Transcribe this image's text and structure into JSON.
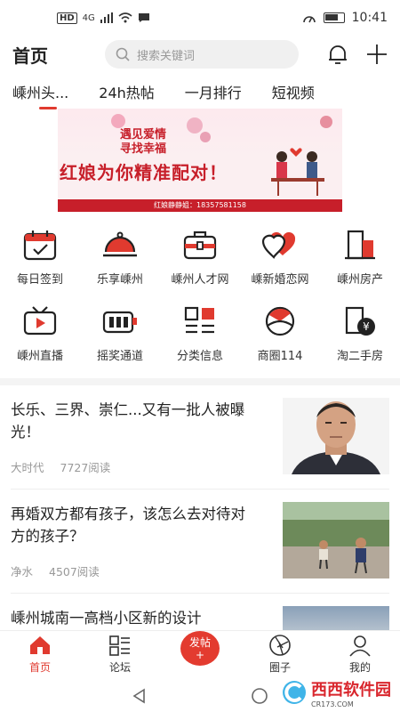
{
  "status": {
    "carrier": "HD",
    "signal": "4G",
    "time": "10:41"
  },
  "header": {
    "title": "首页",
    "search_placeholder": "搜索关键词"
  },
  "tabs": [
    {
      "label": "嵊州头..."
    },
    {
      "label": "24h热帖"
    },
    {
      "label": "一月排行"
    },
    {
      "label": "短视频"
    }
  ],
  "banner": {
    "slogan_line1": "遇见爱情",
    "slogan_line2": "寻找幸福",
    "headline": "红娘为你精准配对！",
    "contact": "红娘静静姐：18357581158"
  },
  "grid": [
    [
      {
        "label": "每日签到",
        "icon": "calendar-check-icon"
      },
      {
        "label": "乐享嵊州",
        "icon": "food-cloche-icon"
      },
      {
        "label": "嵊州人才网",
        "icon": "briefcase-icon"
      },
      {
        "label": "嵊新婚恋网",
        "icon": "hearts-icon"
      },
      {
        "label": "嵊州房产",
        "icon": "building-icon"
      }
    ],
    [
      {
        "label": "嵊州直播",
        "icon": "tv-play-icon"
      },
      {
        "label": "摇奖通道",
        "icon": "lottery-icon"
      },
      {
        "label": "分类信息",
        "icon": "category-grid-icon"
      },
      {
        "label": "商圈114",
        "icon": "shop-circle-icon"
      },
      {
        "label": "淘二手房",
        "icon": "house-yen-icon"
      }
    ]
  ],
  "articles": [
    {
      "title": "长乐、三界、崇仁...又有一批人被曝光！",
      "source": "大时代",
      "reads": "7727阅读"
    },
    {
      "title": "再婚双方都有孩子，该怎么去对待对方的孩子？",
      "source": "净水",
      "reads": "4507阅读"
    },
    {
      "title": "嵊州城南一高档小区新的设计"
    }
  ],
  "bottom_nav": [
    {
      "label": "首页",
      "icon": "home-icon"
    },
    {
      "label": "论坛",
      "icon": "forum-icon"
    },
    {
      "label": "发帖",
      "icon": "post-plus-icon"
    },
    {
      "label": "圈子",
      "icon": "aperture-icon"
    },
    {
      "label": "我的",
      "icon": "person-icon"
    }
  ],
  "watermark": {
    "main": "西西软件园",
    "sub": "CR173.COM"
  },
  "colors": {
    "accent": "#e03a2f",
    "banner_red": "#c71f2a",
    "muted": "#999999"
  }
}
